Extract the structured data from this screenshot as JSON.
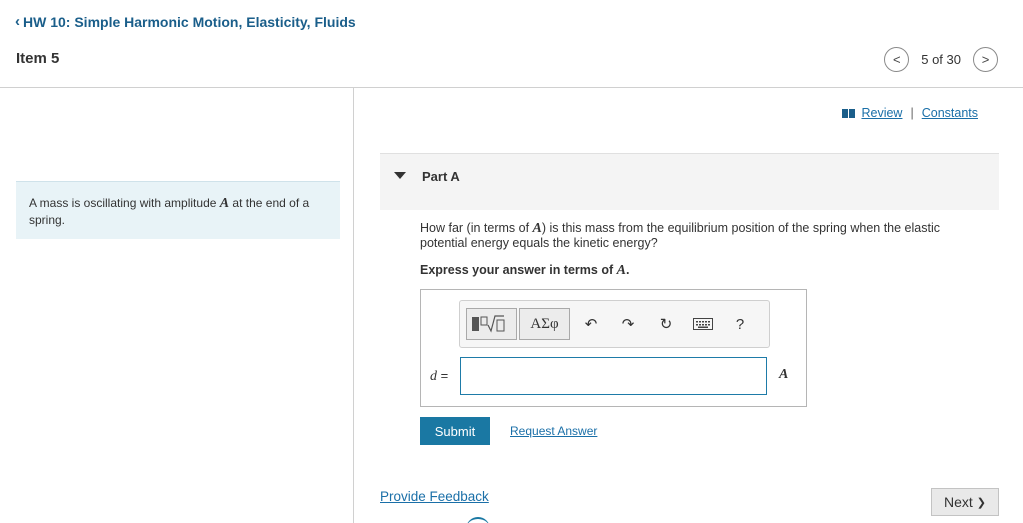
{
  "header": {
    "back_chevron": "‹",
    "assignment_title": "HW 10: Simple Harmonic Motion, Elasticity, Fluids",
    "item_title": "Item 5",
    "pager": {
      "prev": "<",
      "position": "5 of 30",
      "next": ">"
    }
  },
  "problem": {
    "text_before": "A mass is oscillating with amplitude ",
    "variable": "A",
    "text_after": " at the end of a spring."
  },
  "resources": {
    "review": "Review",
    "separator": "|",
    "constants": "Constants"
  },
  "part": {
    "title": "Part A",
    "question_before": "How far (in terms of ",
    "question_var": "A",
    "question_after": ") is this mass from the equilibrium position of the spring when the elastic potential energy equals the kinetic energy?",
    "instruction_before": "Express your answer in terms of ",
    "instruction_var": "A",
    "instruction_after": "."
  },
  "toolbar": {
    "greek_label": "ΑΣφ",
    "undo": "↶",
    "redo": "↷",
    "reset": "↻",
    "help": "?"
  },
  "answer": {
    "variable": "d",
    "equals": " =",
    "value": "",
    "unit": "A"
  },
  "actions": {
    "submit": "Submit",
    "request_answer": "Request Answer",
    "provide_feedback": "Provide Feedback",
    "next": "Next",
    "next_chevron": "❯"
  },
  "colors": {
    "accent": "#1a78a3",
    "link": "#1a6fa8",
    "problem_bg": "#e8f3f7"
  }
}
